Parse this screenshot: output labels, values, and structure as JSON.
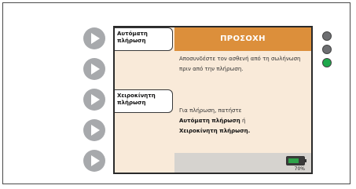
{
  "header": {
    "title": "ΠΡΟΣΟΧΗ"
  },
  "softkeys": {
    "auto_label": "Αυτόματη πλήρωση",
    "manual_label": "Χειροκίνητη πλήρωση"
  },
  "message": {
    "line1": "Αποσυνδέστε τον ασθενή από τη σωλήνωση πριν από την πλήρωση.",
    "line2_prefix": "Για πλήρωση, πατήστε",
    "line2_auto": "Αυτόματη πλήρωση",
    "line2_or": "ή",
    "line2_manual": "Χειροκίνητη πλήρωση."
  },
  "battery": {
    "percent_label": "70%",
    "level": 0.7,
    "color": "#2ea34a"
  },
  "indicators": [
    {
      "name": "led-1",
      "color": "#6d6e71"
    },
    {
      "name": "led-2",
      "color": "#6d6e71"
    },
    {
      "name": "led-3",
      "color": "#1ea84b"
    }
  ],
  "colors": {
    "header": "#dc8f3b",
    "screen": "#f9ead9",
    "softkey": "#a7a9ac"
  }
}
